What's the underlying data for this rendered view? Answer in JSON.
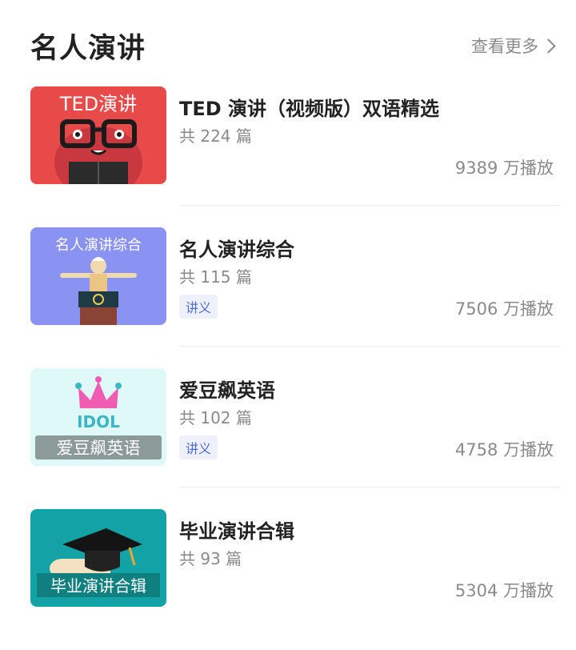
{
  "header": {
    "title": "名人演讲",
    "more_label": "查看更多"
  },
  "items": [
    {
      "name": "TED 演讲（视频版）双语精选",
      "count": "共 224 篇",
      "tag": "",
      "plays": "9389 万播放",
      "cover_text": "TED演讲",
      "cover_bg": "#e84a4a"
    },
    {
      "name": "名人演讲综合",
      "count": "共 115 篇",
      "tag": "讲义",
      "plays": "7506 万播放",
      "cover_text": "名人演讲综合",
      "cover_bg": "#8b93f2"
    },
    {
      "name": "爱豆飙英语",
      "count": "共 102 篇",
      "tag": "讲义",
      "plays": "4758 万播放",
      "cover_text": "爱豆飙英语",
      "cover_logo": "IDOL",
      "cover_bg": "#dff8f8"
    },
    {
      "name": "毕业演讲合辑",
      "count": "共 93 篇",
      "tag": "",
      "plays": "5304 万播放",
      "cover_text": "毕业演讲合辑",
      "cover_bg": "#13a3a6"
    }
  ],
  "colors": {
    "accent_tag": "#4f6bd8",
    "muted": "#8a8a8a"
  }
}
